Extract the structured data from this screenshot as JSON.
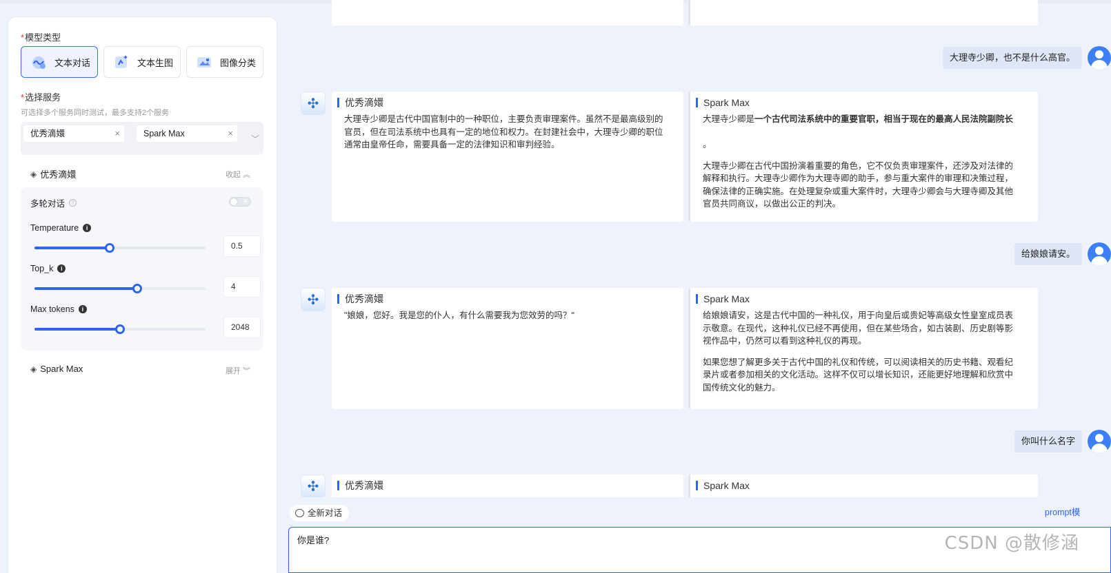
{
  "sidebar": {
    "model_type_label": "模型类型",
    "required_mark": "*",
    "model_types": [
      {
        "label": "文本对话",
        "icon": "chat-bubble-icon",
        "active": true
      },
      {
        "label": "文本生图",
        "icon": "text-to-image-icon",
        "active": false
      },
      {
        "label": "图像分类",
        "icon": "image-classify-icon",
        "active": false
      }
    ],
    "service_label": "选择服务",
    "service_hint": "可选择多个服务同时测试，最多支持2个服务",
    "services": [
      "优秀滴嬛",
      "Spark Max"
    ],
    "groups": [
      {
        "name": "优秀滴嬛",
        "toggle": "收起"
      },
      {
        "name": "Spark Max",
        "toggle": "展开"
      }
    ],
    "params": {
      "multi_turn_label": "多轮对话",
      "multi_turn_state": "关",
      "temperature": {
        "label": "Temperature",
        "value": "0.5",
        "fraction": 0.44
      },
      "top_k": {
        "label": "Top_k",
        "value": "4",
        "fraction": 0.6
      },
      "max_tokens": {
        "label": "Max tokens",
        "value": "2048",
        "fraction": 0.5
      }
    }
  },
  "chat": {
    "messages": [
      {
        "role": "user",
        "text": "大理寺少卿，也不是什么高官。"
      },
      {
        "role": "bots",
        "left": {
          "name": "优秀滴嬛",
          "paragraphs": [
            "大理寺少卿是古代中国官制中的一种职位，主要负责审理案件。虽然不是最高级别的官员，但在司法系统中也具有一定的地位和权力。在封建社会中，大理寺少卿的职位通常由皇帝任命，需要具备一定的法律知识和审判经验。"
          ]
        },
        "right": {
          "name": "Spark Max",
          "bold_prefix": "大理寺少卿是",
          "bold": "一个古代司法系统中的重要官职，相当于现在的最高人民法院副院长",
          "bold_suffix": "。",
          "paragraphs": [
            "大理寺少卿在古代中国扮演着重要的角色，它不仅负责审理案件，还涉及对法律的解释和执行。大理寺少卿作为大理寺卿的助手，参与重大案件的审理和决策过程，确保法律的正确实施。在处理复杂或重大案件时，大理寺少卿会与大理寺卿及其他官员共同商议，以做出公正的判决。"
          ]
        }
      },
      {
        "role": "user",
        "text": "给娘娘请安。"
      },
      {
        "role": "bots",
        "left": {
          "name": "优秀滴嬛",
          "paragraphs": [
            "\"娘娘，您好。我是您的仆人，有什么需要我为您效劳的吗？\""
          ]
        },
        "right": {
          "name": "Spark Max",
          "paragraphs": [
            "给娘娘请安，这是古代中国的一种礼仪，用于向皇后或贵妃等高级女性皇室成员表示敬意。在现代，这种礼仪已经不再使用，但在某些场合，如古装剧、历史剧等影视作品中，仍然可以看到这种礼仪的再现。",
            "如果您想了解更多关于古代中国的礼仪和传统，可以阅读相关的历史书籍、观看纪录片或者参加相关的文化活动。这样不仅可以增长知识，还能更好地理解和欣赏中国传统文化的魅力。"
          ]
        }
      },
      {
        "role": "user",
        "text": "你叫什么名字"
      },
      {
        "role": "bots",
        "left": {
          "name": "优秀滴嬛",
          "paragraphs": []
        },
        "right": {
          "name": "Spark Max",
          "paragraphs": []
        }
      }
    ]
  },
  "footer": {
    "new_chat_label": "全新对话",
    "prompt_link": "prompt模",
    "input_value": "你是谁?",
    "watermark": "CSDN @散修涵"
  },
  "colors": {
    "accent": "#2f64f2",
    "page_bg": "#eef2fb",
    "user_bubble": "#dfe7f7"
  }
}
